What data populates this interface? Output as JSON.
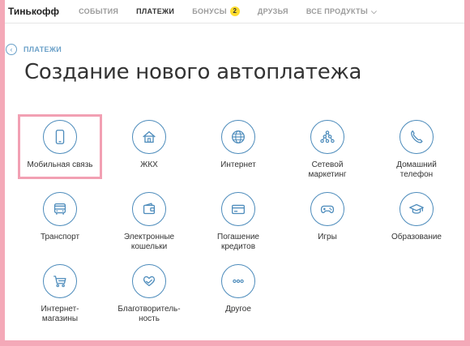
{
  "topnav": {
    "brand": "Тинькофф",
    "items": [
      {
        "label": "СОБЫТИЯ"
      },
      {
        "label": "ПЛАТЕЖИ"
      },
      {
        "label": "БОНУСЫ",
        "badge": "2"
      },
      {
        "label": "ДРУЗЬЯ"
      },
      {
        "label": "ВСЕ ПРОДУКТЫ"
      }
    ]
  },
  "breadcrumb": {
    "label": "ПЛАТЕЖИ"
  },
  "page": {
    "title": "Создание нового автоплатежа"
  },
  "categories": [
    {
      "label": "Мобильная связь",
      "icon": "mobile-phone-icon"
    },
    {
      "label": "ЖКХ",
      "icon": "house-icon"
    },
    {
      "label": "Интернет",
      "icon": "globe-icon"
    },
    {
      "label": "Сетевой\nмаркетинг",
      "icon": "network-icon"
    },
    {
      "label": "Домашний\nтелефон",
      "icon": "handset-icon"
    },
    {
      "label": "Транспорт",
      "icon": "bus-icon"
    },
    {
      "label": "Электронные\nкошельки",
      "icon": "wallet-icon"
    },
    {
      "label": "Погашение\nкредитов",
      "icon": "credit-card-icon"
    },
    {
      "label": "Игры",
      "icon": "gamepad-icon"
    },
    {
      "label": "Образование",
      "icon": "graduation-cap-icon"
    },
    {
      "label": "Интернет-\nмагазины",
      "icon": "shopping-cart-icon"
    },
    {
      "label": "Благотвори­тель-\nность",
      "icon": "heart-hands-icon"
    },
    {
      "label": "Другое",
      "icon": "more-dots-icon"
    }
  ],
  "colors": {
    "accent": "#4c8bbb",
    "highlight": "#f2a0b3",
    "badge": "#ffdd2d"
  }
}
